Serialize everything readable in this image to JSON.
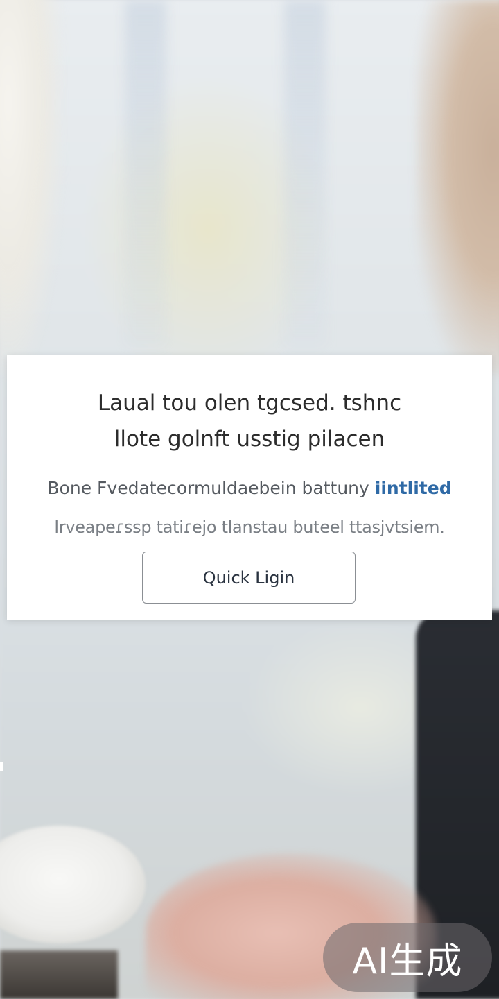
{
  "dialog": {
    "title_line1": "Laual tou olen tgcsed. tshnc",
    "title_line2": "llote golnft usstig pilacen",
    "body_line1_prefix": "Bone Fvedatecormuldaebein battuny ",
    "body_line1_link": "iintlited",
    "body_line2": "lrveapeɾssp tatiɾejo tlanstau buteel ttasjvtsiem.",
    "button_label": "Quick Ligin"
  },
  "watermark": {
    "text": "AI生成"
  },
  "colors": {
    "dialog_bg": "#ffffff",
    "title": "#2c2c2c",
    "body": "#555a60",
    "link": "#2f6aa6",
    "button_border": "#8b8f94"
  }
}
